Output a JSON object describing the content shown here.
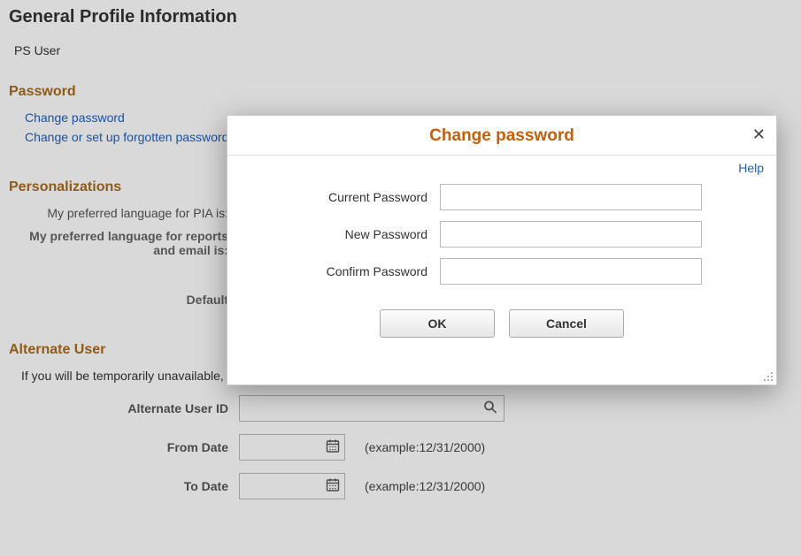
{
  "page": {
    "title": "General Profile Information",
    "user": "PS User"
  },
  "password_section": {
    "header": "Password",
    "change_link": "Change password",
    "forgot_link": "Change or set up forgotten password help"
  },
  "personalizations": {
    "header": "Personalizations",
    "pref_lang_label": "My preferred language for PIA is:",
    "pref_lang_reports_label": "My preferred language for reports and email is:",
    "default_label": "Default"
  },
  "alternate_user": {
    "header": "Alternate User",
    "description": "If you will be temporarily unavailable, you can select an alternate user to receive your routings.",
    "alt_id_label": "Alternate User ID",
    "from_date_label": "From Date",
    "to_date_label": "To Date",
    "date_example": "(example:12/31/2000)"
  },
  "modal": {
    "title": "Change password",
    "help_label": "Help",
    "current_label": "Current Password",
    "new_label": "New Password",
    "confirm_label": "Confirm Password",
    "ok_label": "OK",
    "cancel_label": "Cancel"
  }
}
